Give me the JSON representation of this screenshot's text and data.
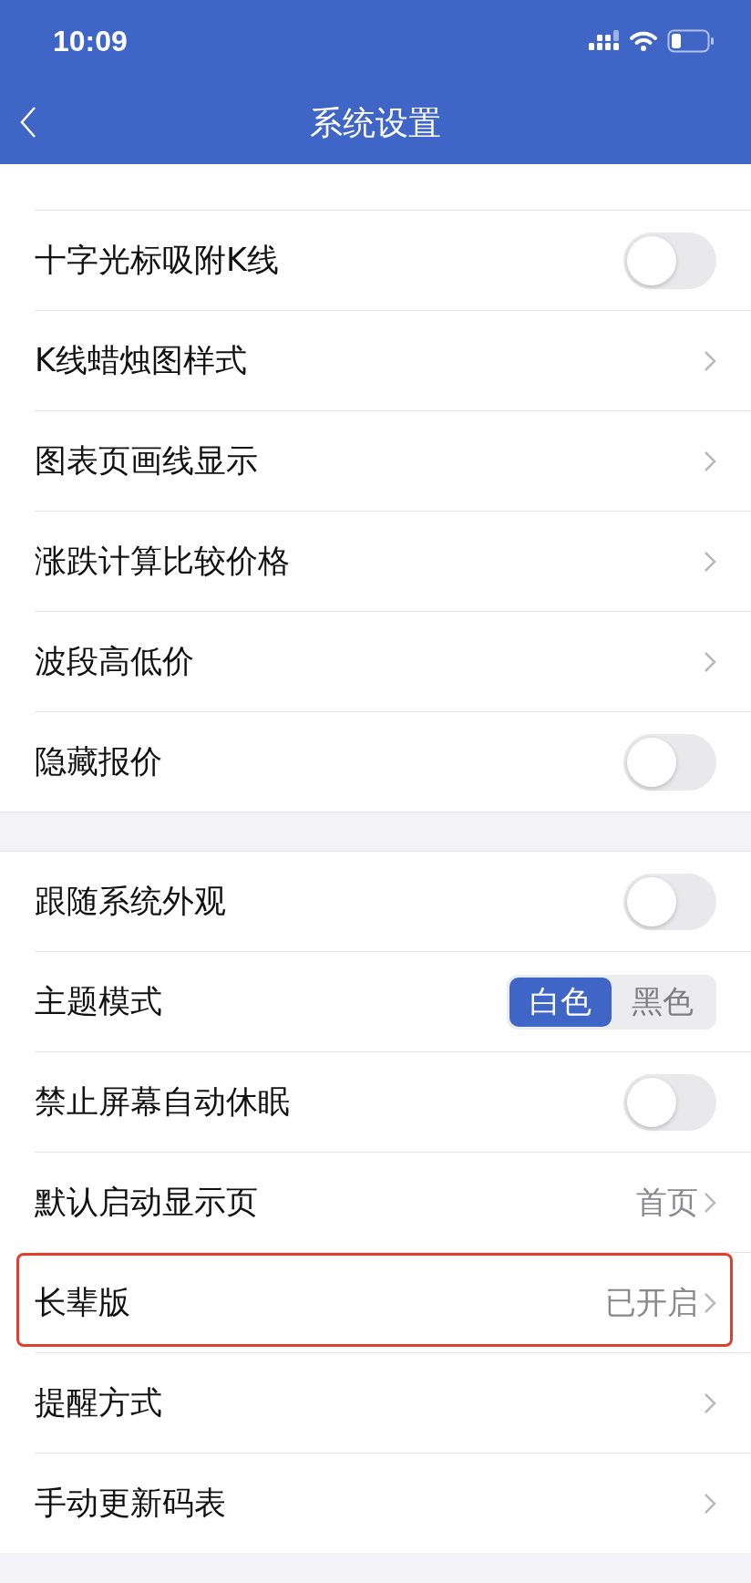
{
  "status_bar": {
    "time": "10:09"
  },
  "nav": {
    "title": "系统设置"
  },
  "sections": [
    {
      "rows": [
        {
          "kind": "toggle",
          "label": "十字光标吸附K线",
          "on": false
        },
        {
          "kind": "link",
          "label": "K线蜡烛图样式"
        },
        {
          "kind": "link",
          "label": "图表页画线显示"
        },
        {
          "kind": "link",
          "label": "涨跌计算比较价格"
        },
        {
          "kind": "link",
          "label": "波段高低价"
        },
        {
          "kind": "toggle",
          "label": "隐藏报价",
          "on": false
        }
      ]
    },
    {
      "rows": [
        {
          "kind": "toggle",
          "label": "跟随系统外观",
          "on": false
        },
        {
          "kind": "segmented",
          "label": "主题模式",
          "options": [
            {
              "label": "白色",
              "selected": true
            },
            {
              "label": "黑色",
              "selected": false
            }
          ]
        },
        {
          "kind": "toggle",
          "label": "禁止屏幕自动休眠",
          "on": false
        },
        {
          "kind": "link",
          "label": "默认启动显示页",
          "value": "首页"
        },
        {
          "kind": "link",
          "label": "长辈版",
          "value": "已开启",
          "highlighted": true
        },
        {
          "kind": "link",
          "label": "提醒方式"
        },
        {
          "kind": "link",
          "label": "手动更新码表"
        }
      ]
    }
  ]
}
